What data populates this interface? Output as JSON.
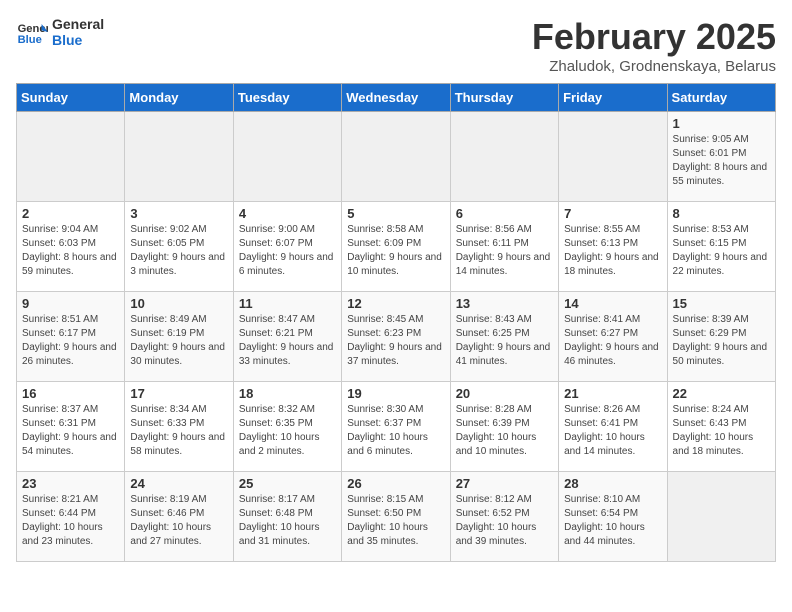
{
  "logo": {
    "line1": "General",
    "line2": "Blue"
  },
  "title": "February 2025",
  "subtitle": "Zhaludok, Grodnenskaya, Belarus",
  "weekdays": [
    "Sunday",
    "Monday",
    "Tuesday",
    "Wednesday",
    "Thursday",
    "Friday",
    "Saturday"
  ],
  "weeks": [
    [
      {
        "day": "",
        "info": ""
      },
      {
        "day": "",
        "info": ""
      },
      {
        "day": "",
        "info": ""
      },
      {
        "day": "",
        "info": ""
      },
      {
        "day": "",
        "info": ""
      },
      {
        "day": "",
        "info": ""
      },
      {
        "day": "1",
        "info": "Sunrise: 9:05 AM\nSunset: 6:01 PM\nDaylight: 8 hours and 55 minutes."
      }
    ],
    [
      {
        "day": "2",
        "info": "Sunrise: 9:04 AM\nSunset: 6:03 PM\nDaylight: 8 hours and 59 minutes."
      },
      {
        "day": "3",
        "info": "Sunrise: 9:02 AM\nSunset: 6:05 PM\nDaylight: 9 hours and 3 minutes."
      },
      {
        "day": "4",
        "info": "Sunrise: 9:00 AM\nSunset: 6:07 PM\nDaylight: 9 hours and 6 minutes."
      },
      {
        "day": "5",
        "info": "Sunrise: 8:58 AM\nSunset: 6:09 PM\nDaylight: 9 hours and 10 minutes."
      },
      {
        "day": "6",
        "info": "Sunrise: 8:56 AM\nSunset: 6:11 PM\nDaylight: 9 hours and 14 minutes."
      },
      {
        "day": "7",
        "info": "Sunrise: 8:55 AM\nSunset: 6:13 PM\nDaylight: 9 hours and 18 minutes."
      },
      {
        "day": "8",
        "info": "Sunrise: 8:53 AM\nSunset: 6:15 PM\nDaylight: 9 hours and 22 minutes."
      }
    ],
    [
      {
        "day": "9",
        "info": "Sunrise: 8:51 AM\nSunset: 6:17 PM\nDaylight: 9 hours and 26 minutes."
      },
      {
        "day": "10",
        "info": "Sunrise: 8:49 AM\nSunset: 6:19 PM\nDaylight: 9 hours and 30 minutes."
      },
      {
        "day": "11",
        "info": "Sunrise: 8:47 AM\nSunset: 6:21 PM\nDaylight: 9 hours and 33 minutes."
      },
      {
        "day": "12",
        "info": "Sunrise: 8:45 AM\nSunset: 6:23 PM\nDaylight: 9 hours and 37 minutes."
      },
      {
        "day": "13",
        "info": "Sunrise: 8:43 AM\nSunset: 6:25 PM\nDaylight: 9 hours and 41 minutes."
      },
      {
        "day": "14",
        "info": "Sunrise: 8:41 AM\nSunset: 6:27 PM\nDaylight: 9 hours and 46 minutes."
      },
      {
        "day": "15",
        "info": "Sunrise: 8:39 AM\nSunset: 6:29 PM\nDaylight: 9 hours and 50 minutes."
      }
    ],
    [
      {
        "day": "16",
        "info": "Sunrise: 8:37 AM\nSunset: 6:31 PM\nDaylight: 9 hours and 54 minutes."
      },
      {
        "day": "17",
        "info": "Sunrise: 8:34 AM\nSunset: 6:33 PM\nDaylight: 9 hours and 58 minutes."
      },
      {
        "day": "18",
        "info": "Sunrise: 8:32 AM\nSunset: 6:35 PM\nDaylight: 10 hours and 2 minutes."
      },
      {
        "day": "19",
        "info": "Sunrise: 8:30 AM\nSunset: 6:37 PM\nDaylight: 10 hours and 6 minutes."
      },
      {
        "day": "20",
        "info": "Sunrise: 8:28 AM\nSunset: 6:39 PM\nDaylight: 10 hours and 10 minutes."
      },
      {
        "day": "21",
        "info": "Sunrise: 8:26 AM\nSunset: 6:41 PM\nDaylight: 10 hours and 14 minutes."
      },
      {
        "day": "22",
        "info": "Sunrise: 8:24 AM\nSunset: 6:43 PM\nDaylight: 10 hours and 18 minutes."
      }
    ],
    [
      {
        "day": "23",
        "info": "Sunrise: 8:21 AM\nSunset: 6:44 PM\nDaylight: 10 hours and 23 minutes."
      },
      {
        "day": "24",
        "info": "Sunrise: 8:19 AM\nSunset: 6:46 PM\nDaylight: 10 hours and 27 minutes."
      },
      {
        "day": "25",
        "info": "Sunrise: 8:17 AM\nSunset: 6:48 PM\nDaylight: 10 hours and 31 minutes."
      },
      {
        "day": "26",
        "info": "Sunrise: 8:15 AM\nSunset: 6:50 PM\nDaylight: 10 hours and 35 minutes."
      },
      {
        "day": "27",
        "info": "Sunrise: 8:12 AM\nSunset: 6:52 PM\nDaylight: 10 hours and 39 minutes."
      },
      {
        "day": "28",
        "info": "Sunrise: 8:10 AM\nSunset: 6:54 PM\nDaylight: 10 hours and 44 minutes."
      },
      {
        "day": "",
        "info": ""
      }
    ]
  ]
}
